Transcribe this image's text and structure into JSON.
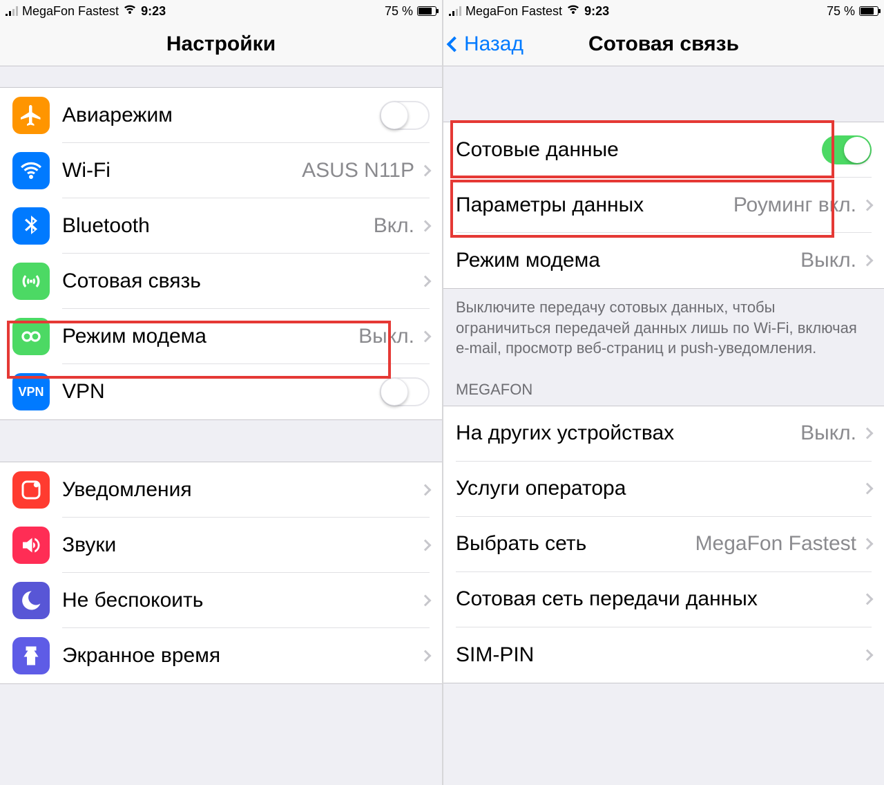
{
  "status": {
    "carrier": "MegaFon Fastest",
    "time": "9:23",
    "battery_pct": "75 %"
  },
  "left": {
    "title": "Настройки",
    "rows": {
      "airplane": {
        "label": "Авиарежим"
      },
      "wifi": {
        "label": "Wi-Fi",
        "detail": "ASUS N11P"
      },
      "bluetooth": {
        "label": "Bluetooth",
        "detail": "Вкл."
      },
      "cellular": {
        "label": "Сотовая связь"
      },
      "hotspot": {
        "label": "Режим модема",
        "detail": "Выкл."
      },
      "vpn": {
        "label": "VPN"
      },
      "notifications": {
        "label": "Уведомления"
      },
      "sounds": {
        "label": "Звуки"
      },
      "dnd": {
        "label": "Не беспокоить"
      },
      "screentime": {
        "label": "Экранное время"
      }
    }
  },
  "right": {
    "back": "Назад",
    "title": "Сотовая связь",
    "rows": {
      "cellular_data": {
        "label": "Сотовые данные"
      },
      "data_options": {
        "label": "Параметры данных",
        "detail": "Роуминг вкл."
      },
      "hotspot": {
        "label": "Режим модема",
        "detail": "Выкл."
      },
      "on_other_devices": {
        "label": "На других устройствах",
        "detail": "Выкл."
      },
      "carrier_services": {
        "label": "Услуги оператора"
      },
      "network_selection": {
        "label": "Выбрать сеть",
        "detail": "MegaFon Fastest"
      },
      "cellular_data_network": {
        "label": "Сотовая сеть передачи данных"
      },
      "sim_pin": {
        "label": "SIM-PIN"
      }
    },
    "footer_text": "Выключите передачу сотовых данных, чтобы ограничиться передачей данных лишь по Wi-Fi, включая e-mail, просмотр веб-страниц и push-уведомления.",
    "section_header": "MEGAFON"
  },
  "colors": {
    "orange": "#ff9500",
    "blue": "#007aff",
    "green": "#4cd964",
    "cell_green": "#34c759",
    "red": "#ff3b30",
    "pink": "#ff2d55",
    "purple": "#5856d6",
    "indigo": "#5e5ce6"
  }
}
